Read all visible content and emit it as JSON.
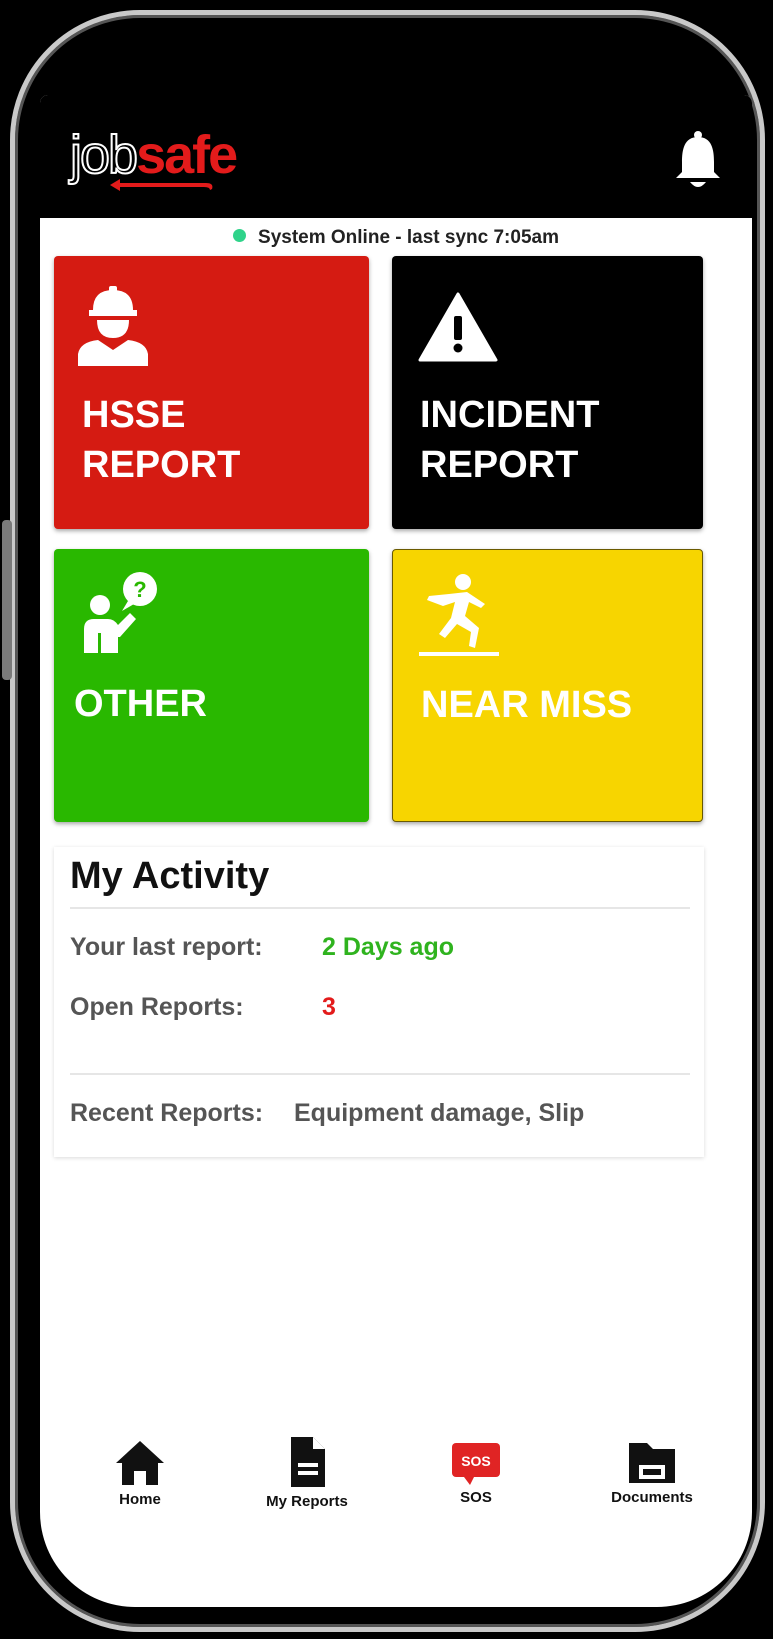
{
  "app": {
    "logo_job": "job",
    "logo_safe": "safe",
    "brand_red": "#e31b1b"
  },
  "header": {
    "bell_icon": "bell-icon"
  },
  "status": {
    "text": "System Online - last sync 7:05am",
    "dot_color": "#2fd38a"
  },
  "tiles": [
    {
      "label": "HSSE\nREPORT",
      "icon": "construction-worker-icon",
      "color": "#d51b12"
    },
    {
      "label": "INCIDENT\nREPORT",
      "icon": "warning-triangle-icon",
      "color": "#000000"
    },
    {
      "label": "OTHER",
      "icon": "person-question-icon",
      "color": "#29b800"
    },
    {
      "label": "NEAR MISS",
      "icon": "slip-fall-icon",
      "color": "#f7d500"
    }
  ],
  "activity": {
    "title": "My Activity",
    "last_report_label": "Your last report:",
    "last_report_value": "2 Days ago",
    "last_report_color": "#2fb31e",
    "open_reports_label": "Open Reports:",
    "open_reports_value": "3",
    "open_reports_color": "#e31b1b",
    "recent_label": "Recent Reports:",
    "recent_value": "Equipment damage, Slip"
  },
  "nav": [
    {
      "label": "Home",
      "icon": "home-icon"
    },
    {
      "label": "My Reports",
      "icon": "document-icon"
    },
    {
      "label": "SOS",
      "icon": "sos-icon",
      "badge": "SOS"
    },
    {
      "label": "Documents",
      "icon": "folder-icon"
    }
  ]
}
